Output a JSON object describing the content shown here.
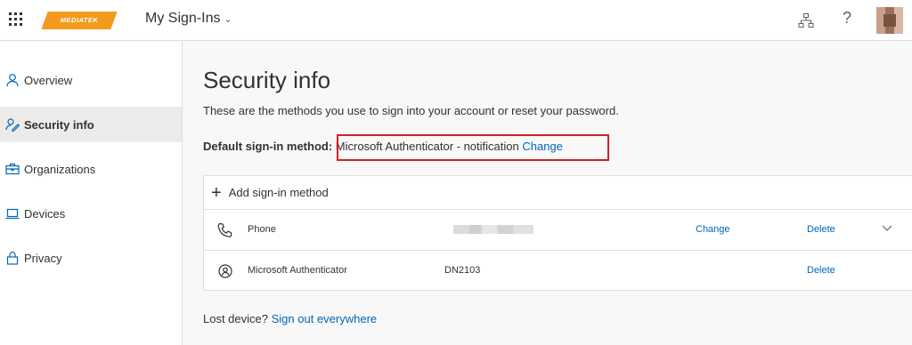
{
  "header": {
    "logo_text": "MEDIATEK",
    "app_title": "My Sign-Ins",
    "help_glyph": "?"
  },
  "sidebar": {
    "items": [
      {
        "label": "Overview",
        "icon": "person-icon"
      },
      {
        "label": "Security info",
        "icon": "security-info-icon",
        "active": true
      },
      {
        "label": "Organizations",
        "icon": "briefcase-icon"
      },
      {
        "label": "Devices",
        "icon": "laptop-icon"
      },
      {
        "label": "Privacy",
        "icon": "lock-icon"
      }
    ]
  },
  "main": {
    "title": "Security info",
    "subtitle": "These are the methods you use to sign into your account or reset your password.",
    "default_label": "Default sign-in method:",
    "default_value": "Microsoft Authenticator - notification",
    "default_change": "Change",
    "add_method": "Add sign-in method",
    "methods": [
      {
        "name": "Phone",
        "detail": "",
        "change": "Change",
        "delete": "Delete",
        "icon": "phone-icon",
        "detail_obscured": true
      },
      {
        "name": "Microsoft Authenticator",
        "detail": "DN2103",
        "change": "",
        "delete": "Delete",
        "icon": "authenticator-icon"
      }
    ],
    "lost_label": "Lost device?",
    "lost_link": "Sign out everywhere"
  },
  "colors": {
    "link": "#0067b8",
    "logo": "#f39a1e",
    "highlight_border": "#d42020"
  }
}
